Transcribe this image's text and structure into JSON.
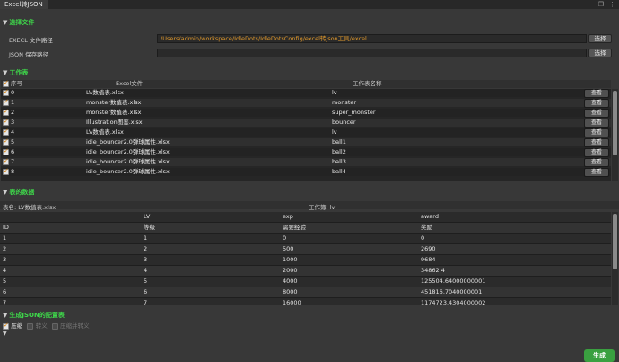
{
  "window": {
    "tab_title": "Excel转JSON",
    "icons": [
      "restore-icon",
      "menu-icon"
    ]
  },
  "select_files": {
    "section_title": "选择文件",
    "excel_label": "EXECL 文件路径",
    "excel_value": "/Users/admin/workspace/IdleDots/IdleDotsConfig/excel转json工具/excel",
    "json_label": "JSON 保存路径",
    "json_value": "",
    "choose_label": "选择"
  },
  "worksheets": {
    "section_title": "工作表",
    "headers": {
      "index": "序号",
      "file": "Excel文件",
      "sheet": "工作表名称"
    },
    "view_label": "查看",
    "rows": [
      {
        "index": "0",
        "file": "LV数值表.xlsx",
        "sheet": "lv"
      },
      {
        "index": "1",
        "file": "monster数值表.xlsx",
        "sheet": "monster"
      },
      {
        "index": "2",
        "file": "monster数值表.xlsx",
        "sheet": "super_monster"
      },
      {
        "index": "3",
        "file": "Illustration图鉴.xlsx",
        "sheet": "bouncer"
      },
      {
        "index": "4",
        "file": "LV数值表.xlsx",
        "sheet": "lv"
      },
      {
        "index": "5",
        "file": "idle_bouncer2.0弹球属性.xlsx",
        "sheet": "ball1"
      },
      {
        "index": "6",
        "file": "idle_bouncer2.0弹球属性.xlsx",
        "sheet": "ball2"
      },
      {
        "index": "7",
        "file": "idle_bouncer2.0弹球属性.xlsx",
        "sheet": "ball3"
      },
      {
        "index": "8",
        "file": "idle_bouncer2.0弹球属性.xlsx",
        "sheet": "ball4"
      }
    ]
  },
  "table_data": {
    "section_title": "表的数据",
    "table_name": "表名: LV数值表.xlsx",
    "sheet_name": "工作簿: lv",
    "col_keys": [
      "",
      "LV",
      "exp",
      "award"
    ],
    "col_desc": [
      "ID",
      "等级",
      "需要经验",
      "奖励"
    ],
    "rows": [
      [
        "1",
        "1",
        "0",
        "0"
      ],
      [
        "2",
        "2",
        "500",
        "2690"
      ],
      [
        "3",
        "3",
        "1000",
        "9684"
      ],
      [
        "4",
        "4",
        "2000",
        "34862.4"
      ],
      [
        "5",
        "5",
        "4000",
        "125504.64000000001"
      ],
      [
        "6",
        "6",
        "8000",
        "451816.7040000001"
      ],
      [
        "7",
        "7",
        "16000",
        "1174723.4304000002"
      ]
    ]
  },
  "json_config": {
    "section_title": "生成JSON的配置表",
    "options": [
      {
        "label": "压缩",
        "checked": true
      },
      {
        "label": "转义",
        "checked": false
      },
      {
        "label": "压缩并转义",
        "checked": false
      }
    ]
  },
  "generate_label": "生成"
}
